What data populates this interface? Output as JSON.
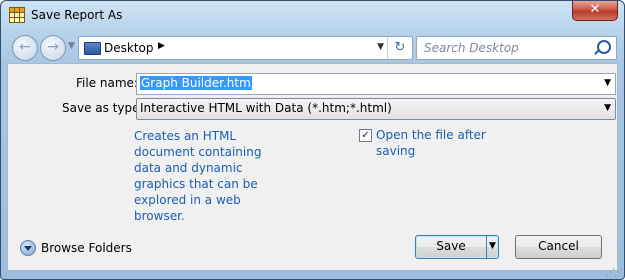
{
  "window": {
    "title": "Save Report As",
    "close_glyph": "✕"
  },
  "nav": {
    "back_icon": "←",
    "forward_icon": "→",
    "location": "Desktop",
    "refresh_icon": "↻",
    "search_placeholder": "Search Desktop"
  },
  "form": {
    "file_name_label": "File name:",
    "file_name_value": "Graph Builder.htm",
    "save_type_label": "Save as type:",
    "save_type_value": "Interactive HTML with Data (*.htm;*.html)",
    "description": "Creates an HTML document containing data and dynamic graphics that can be explored in a web browser.",
    "open_after_label": "Open the file after saving",
    "open_after_checked": true
  },
  "footer": {
    "browse_folders_label": "Browse Folders",
    "save_label": "Save",
    "cancel_label": "Cancel"
  }
}
